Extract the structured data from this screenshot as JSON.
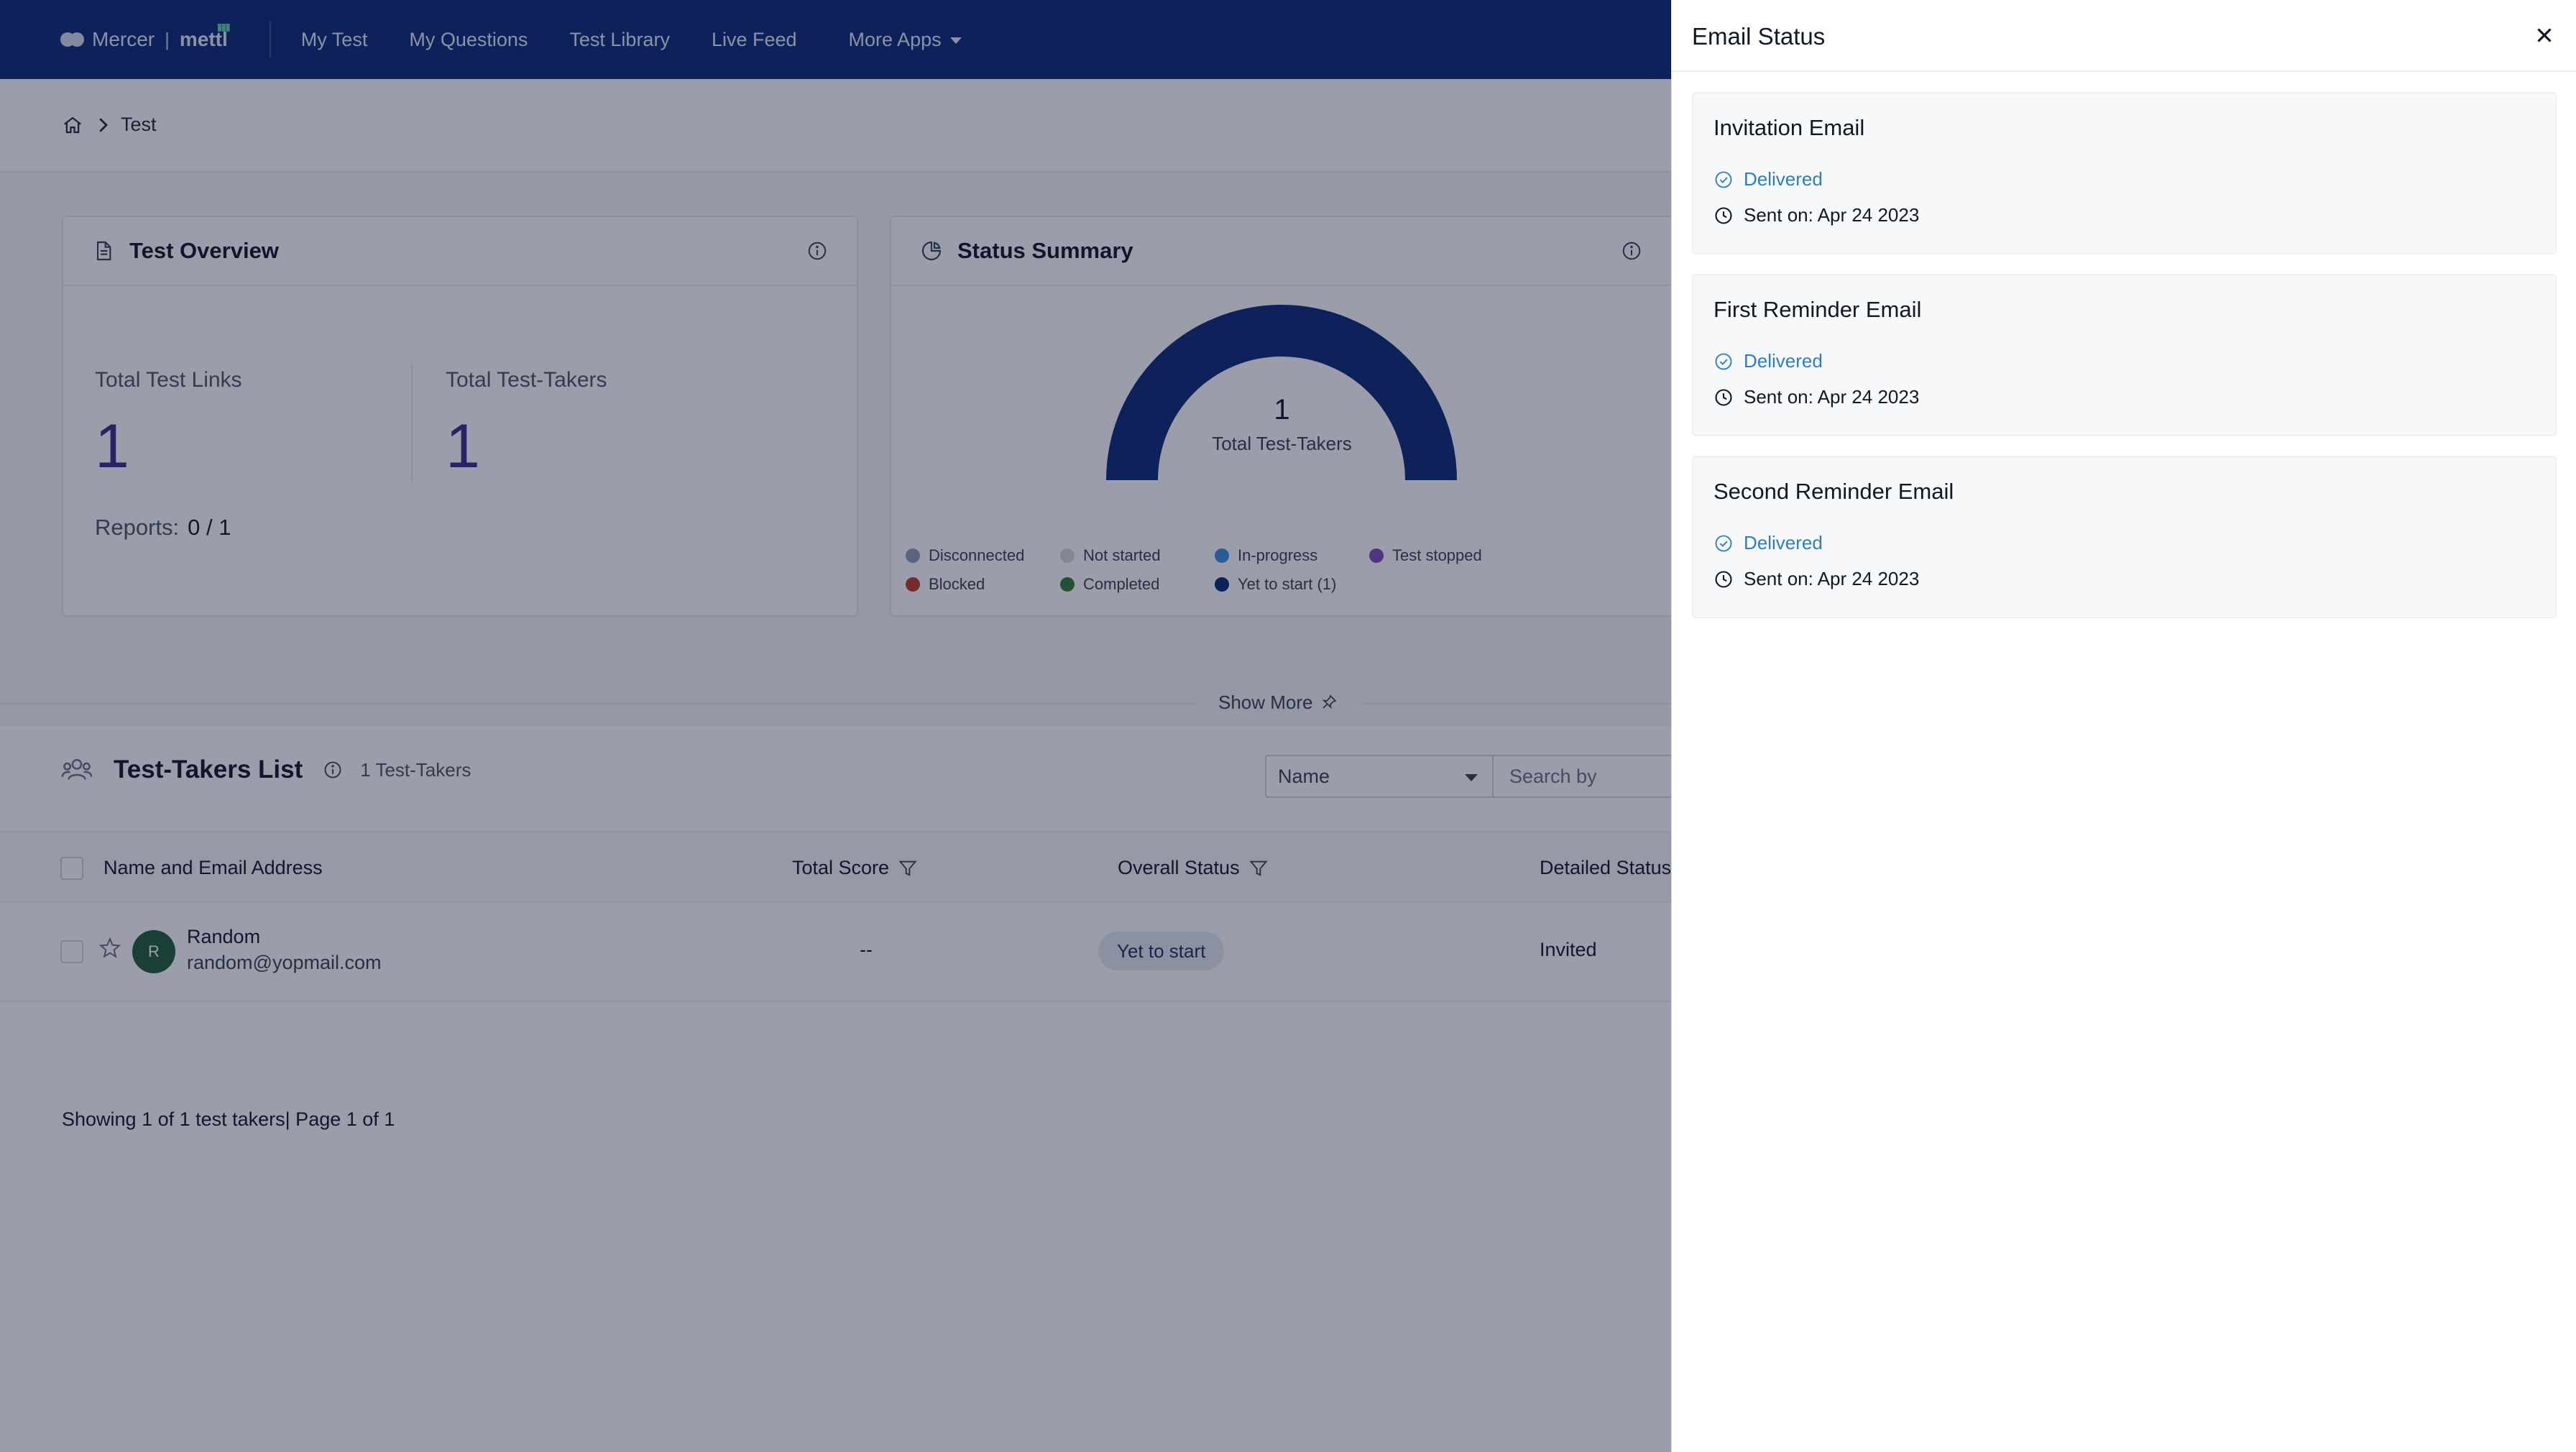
{
  "nav": {
    "brand": {
      "company": "Mercer",
      "separator": "|",
      "product": "mettl"
    },
    "items": [
      "My Test",
      "My Questions",
      "Test Library",
      "Live Feed"
    ],
    "more_apps": "More Apps"
  },
  "breadcrumb": {
    "current": "Test"
  },
  "overview": {
    "title": "Test Overview",
    "total_links_label": "Total Test Links",
    "total_links_value": "1",
    "total_takers_label": "Total Test-Takers",
    "total_takers_value": "1",
    "reports_label": "Reports:",
    "reports_value": "0 / 1"
  },
  "status_summary": {
    "title": "Status Summary",
    "center_value": "1",
    "center_label": "Total Test-Takers",
    "legend": [
      {
        "label": "Disconnected",
        "color": "#8e9bb4"
      },
      {
        "label": "Not started",
        "color": "#d4d7dd"
      },
      {
        "label": "In-progress",
        "color": "#3b8fd9"
      },
      {
        "label": "Test stopped",
        "color": "#7b4bb8"
      },
      {
        "label": "Blocked",
        "color": "#c0392b"
      },
      {
        "label": "Completed",
        "color": "#2e7d32"
      },
      {
        "label": "Yet to start (1)",
        "color": "#0b2a78"
      }
    ]
  },
  "show_more": "Show More",
  "list": {
    "title": "Test-Takers List",
    "count": "1 Test-Takers",
    "filter_field": "Name",
    "search_placeholder": "Search by",
    "columns": {
      "name": "Name and Email Address",
      "score": "Total Score",
      "overall": "Overall Status",
      "detailed": "Detailed Status"
    },
    "rows": [
      {
        "initial": "R",
        "name": "Random",
        "email": "random@yopmail.com",
        "score": "--",
        "overall_status": "Yet to start",
        "detailed_status": "Invited"
      }
    ],
    "footer": "Showing 1 of 1 test takers| Page 1 of 1"
  },
  "panel": {
    "title": "Email Status",
    "emails": [
      {
        "name": "Invitation Email",
        "status": "Delivered",
        "sent": "Sent on: Apr 24 2023"
      },
      {
        "name": "First Reminder Email",
        "status": "Delivered",
        "sent": "Sent on: Apr 24 2023"
      },
      {
        "name": "Second Reminder Email",
        "status": "Delivered",
        "sent": "Sent on: Apr 24 2023"
      }
    ]
  },
  "colors": {
    "navbar": "#0b2a78",
    "gauge": "#0b2a78",
    "delivered": "#2b7fc1",
    "overlay": "rgba(16,25,52,0.42)"
  },
  "chart_data": {
    "type": "pie",
    "categories": [
      "Yet to start"
    ],
    "values": [
      1
    ]
  }
}
